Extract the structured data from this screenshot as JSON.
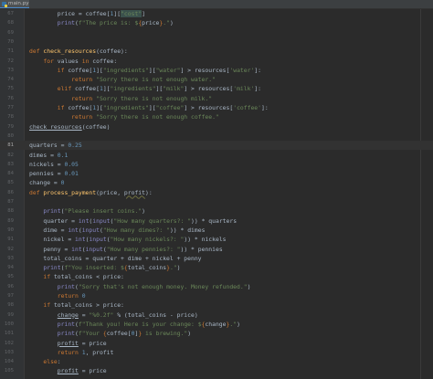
{
  "tab": {
    "label": "main.py"
  },
  "lines": [
    {
      "n": "67",
      "t": [
        [
          "        ",
          "plain"
        ],
        [
          "price",
          "plain"
        ],
        [
          " = coffee[",
          "plain"
        ],
        [
          "1",
          "num"
        ],
        [
          "][",
          "plain"
        ],
        [
          "\"cost\"",
          "str hl"
        ],
        [
          "]",
          "plain"
        ]
      ]
    },
    {
      "n": "68",
      "t": [
        [
          "        ",
          "plain"
        ],
        [
          "print",
          "bi"
        ],
        [
          "(",
          "plain"
        ],
        [
          "f\"The price is: $",
          "str"
        ],
        [
          "{",
          "kw"
        ],
        [
          "price",
          "plain"
        ],
        [
          "}",
          "kw"
        ],
        [
          ".\"",
          "str"
        ],
        [
          ")",
          "plain"
        ]
      ]
    },
    {
      "n": "69",
      "t": []
    },
    {
      "n": "70",
      "t": []
    },
    {
      "n": "71",
      "t": [
        [
          "def ",
          "kw"
        ],
        [
          "check_resources",
          "fn"
        ],
        [
          "(coffee):",
          "plain"
        ]
      ]
    },
    {
      "n": "72",
      "t": [
        [
          "    ",
          "plain"
        ],
        [
          "for ",
          "kw"
        ],
        [
          "values ",
          "plain"
        ],
        [
          "in ",
          "kw"
        ],
        [
          "coffee:",
          "plain"
        ]
      ]
    },
    {
      "n": "73",
      "t": [
        [
          "        ",
          "plain"
        ],
        [
          "if ",
          "kw"
        ],
        [
          "coffee[",
          "plain"
        ],
        [
          "1",
          "num"
        ],
        [
          "][",
          "plain"
        ],
        [
          "\"ingredients\"",
          "str"
        ],
        [
          "][",
          "plain"
        ],
        [
          "\"water\"",
          "str"
        ],
        [
          "] > resources[",
          "plain"
        ],
        [
          "'water'",
          "str"
        ],
        [
          "]:",
          "plain"
        ]
      ]
    },
    {
      "n": "74",
      "t": [
        [
          "            ",
          "plain"
        ],
        [
          "return ",
          "kw"
        ],
        [
          "\"Sorry there is not enough water.\"",
          "str"
        ]
      ]
    },
    {
      "n": "75",
      "t": [
        [
          "        ",
          "plain"
        ],
        [
          "elif ",
          "kw"
        ],
        [
          "coffee[",
          "plain"
        ],
        [
          "1",
          "num"
        ],
        [
          "][",
          "plain"
        ],
        [
          "\"ingredients\"",
          "str"
        ],
        [
          "][",
          "plain"
        ],
        [
          "\"milk\"",
          "str"
        ],
        [
          "] > resources[",
          "plain"
        ],
        [
          "'milk'",
          "str"
        ],
        [
          "]:",
          "plain"
        ]
      ]
    },
    {
      "n": "76",
      "t": [
        [
          "            ",
          "plain"
        ],
        [
          "return ",
          "kw"
        ],
        [
          "\"Sorry there is not enough milk.\"",
          "str"
        ]
      ]
    },
    {
      "n": "77",
      "t": [
        [
          "        ",
          "plain"
        ],
        [
          "if ",
          "kw"
        ],
        [
          "coffee[",
          "plain"
        ],
        [
          "1",
          "num"
        ],
        [
          "][",
          "plain"
        ],
        [
          "\"ingredients\"",
          "str"
        ],
        [
          "][",
          "plain"
        ],
        [
          "\"coffee\"",
          "str"
        ],
        [
          "] > resources[",
          "plain"
        ],
        [
          "'coffee'",
          "str"
        ],
        [
          "]:",
          "plain"
        ]
      ]
    },
    {
      "n": "78",
      "t": [
        [
          "            ",
          "plain"
        ],
        [
          "return ",
          "kw"
        ],
        [
          "\"Sorry there is not enough coffee.\"",
          "str"
        ]
      ]
    },
    {
      "n": "79",
      "t": [
        [
          "check_resources",
          "plain ul"
        ],
        [
          "(coffee)",
          "plain"
        ]
      ]
    },
    {
      "n": "80",
      "t": []
    },
    {
      "n": "81",
      "t": [
        [
          "quarters = ",
          "plain"
        ],
        [
          "0.25",
          "num"
        ]
      ],
      "current": true
    },
    {
      "n": "82",
      "t": [
        [
          "dimes = ",
          "plain"
        ],
        [
          "0.1",
          "num"
        ]
      ]
    },
    {
      "n": "83",
      "t": [
        [
          "nickels = ",
          "plain"
        ],
        [
          "0.05",
          "num"
        ]
      ]
    },
    {
      "n": "84",
      "t": [
        [
          "pennies = ",
          "plain"
        ],
        [
          "0.01",
          "num"
        ]
      ]
    },
    {
      "n": "85",
      "t": [
        [
          "change = ",
          "plain"
        ],
        [
          "0",
          "num"
        ]
      ]
    },
    {
      "n": "86",
      "t": [
        [
          "def ",
          "kw"
        ],
        [
          "process_payment",
          "fn"
        ],
        [
          "(price, ",
          "plain"
        ],
        [
          "profit",
          "plain underwave"
        ],
        [
          "):",
          "plain"
        ]
      ]
    },
    {
      "n": "87",
      "t": []
    },
    {
      "n": "88",
      "t": [
        [
          "    ",
          "plain"
        ],
        [
          "print",
          "bi"
        ],
        [
          "(",
          "plain"
        ],
        [
          "\"Please insert coins.\"",
          "str"
        ],
        [
          ")",
          "plain"
        ]
      ]
    },
    {
      "n": "89",
      "t": [
        [
          "    ",
          "plain"
        ],
        [
          "quarter = ",
          "plain"
        ],
        [
          "int",
          "bi"
        ],
        [
          "(",
          "plain"
        ],
        [
          "input",
          "bi"
        ],
        [
          "(",
          "plain"
        ],
        [
          "\"How many quarters?: \"",
          "str"
        ],
        [
          ")) * quarters",
          "plain"
        ]
      ]
    },
    {
      "n": "90",
      "t": [
        [
          "    ",
          "plain"
        ],
        [
          "dime = ",
          "plain"
        ],
        [
          "int",
          "bi"
        ],
        [
          "(",
          "plain"
        ],
        [
          "input",
          "bi"
        ],
        [
          "(",
          "plain"
        ],
        [
          "\"How many dimes?: \"",
          "str"
        ],
        [
          ")) * dimes",
          "plain"
        ]
      ]
    },
    {
      "n": "91",
      "t": [
        [
          "    ",
          "plain"
        ],
        [
          "nickel = ",
          "plain"
        ],
        [
          "int",
          "bi"
        ],
        [
          "(",
          "plain"
        ],
        [
          "input",
          "bi"
        ],
        [
          "(",
          "plain"
        ],
        [
          "\"How many nickels?: \"",
          "str"
        ],
        [
          ")) * nickels",
          "plain"
        ]
      ]
    },
    {
      "n": "92",
      "t": [
        [
          "    ",
          "plain"
        ],
        [
          "penny = ",
          "plain"
        ],
        [
          "int",
          "bi"
        ],
        [
          "(",
          "plain"
        ],
        [
          "input",
          "bi"
        ],
        [
          "(",
          "plain"
        ],
        [
          "\"How many pennies?: \"",
          "str"
        ],
        [
          ")) * pennies",
          "plain"
        ]
      ]
    },
    {
      "n": "93",
      "t": [
        [
          "    ",
          "plain"
        ],
        [
          "total_coins = quarter + dime + nickel + penny",
          "plain"
        ]
      ]
    },
    {
      "n": "94",
      "t": [
        [
          "    ",
          "plain"
        ],
        [
          "print",
          "bi"
        ],
        [
          "(",
          "plain"
        ],
        [
          "f\"You inserted: $",
          "str"
        ],
        [
          "{",
          "kw"
        ],
        [
          "total_coins",
          "plain"
        ],
        [
          "}",
          "kw"
        ],
        [
          ".\"",
          "str"
        ],
        [
          ")",
          "plain"
        ]
      ]
    },
    {
      "n": "95",
      "t": [
        [
          "    ",
          "plain"
        ],
        [
          "if ",
          "kw"
        ],
        [
          "total_coins < price:",
          "plain"
        ]
      ]
    },
    {
      "n": "96",
      "t": [
        [
          "        ",
          "plain"
        ],
        [
          "print",
          "bi"
        ],
        [
          "(",
          "plain"
        ],
        [
          "\"Sorry that's not enough money. Money refunded.\"",
          "str"
        ],
        [
          ")",
          "plain"
        ]
      ]
    },
    {
      "n": "97",
      "t": [
        [
          "        ",
          "plain"
        ],
        [
          "return ",
          "kw"
        ],
        [
          "0",
          "num"
        ]
      ]
    },
    {
      "n": "98",
      "t": [
        [
          "    ",
          "plain"
        ],
        [
          "if ",
          "kw"
        ],
        [
          "total_coins > price:",
          "plain"
        ]
      ]
    },
    {
      "n": "99",
      "t": [
        [
          "        ",
          "plain"
        ],
        [
          "change",
          "plain ul"
        ],
        [
          " = ",
          "plain"
        ],
        [
          "\"%0.2f\"",
          "str"
        ],
        [
          " % (total_coins - price)",
          "plain"
        ]
      ]
    },
    {
      "n": "100",
      "t": [
        [
          "        ",
          "plain"
        ],
        [
          "print",
          "bi"
        ],
        [
          "(",
          "plain"
        ],
        [
          "f\"Thank you! Here is your change: $",
          "str"
        ],
        [
          "{",
          "kw"
        ],
        [
          "change",
          "plain"
        ],
        [
          "}",
          "kw"
        ],
        [
          ".\"",
          "str"
        ],
        [
          ")",
          "plain"
        ]
      ]
    },
    {
      "n": "101",
      "t": [
        [
          "        ",
          "plain"
        ],
        [
          "print",
          "bi"
        ],
        [
          "(",
          "plain"
        ],
        [
          "f\"Your ",
          "str"
        ],
        [
          "{",
          "kw"
        ],
        [
          "coffee[",
          "plain"
        ],
        [
          "0",
          "num"
        ],
        [
          "]",
          "plain"
        ],
        [
          "}",
          "kw"
        ],
        [
          " is brewing.\"",
          "str"
        ],
        [
          ")",
          "plain"
        ]
      ]
    },
    {
      "n": "102",
      "t": [
        [
          "        ",
          "plain"
        ],
        [
          "profit",
          "plain ul"
        ],
        [
          " = price",
          "plain"
        ]
      ]
    },
    {
      "n": "103",
      "t": [
        [
          "        ",
          "plain"
        ],
        [
          "return ",
          "kw"
        ],
        [
          "1",
          "num"
        ],
        [
          ", profit",
          "plain"
        ]
      ]
    },
    {
      "n": "104",
      "t": [
        [
          "    ",
          "plain"
        ],
        [
          "else",
          "kw"
        ],
        [
          ":",
          "plain"
        ]
      ]
    },
    {
      "n": "105",
      "t": [
        [
          "        ",
          "plain"
        ],
        [
          "profit",
          "plain ul"
        ],
        [
          " = price",
          "plain"
        ]
      ]
    }
  ]
}
